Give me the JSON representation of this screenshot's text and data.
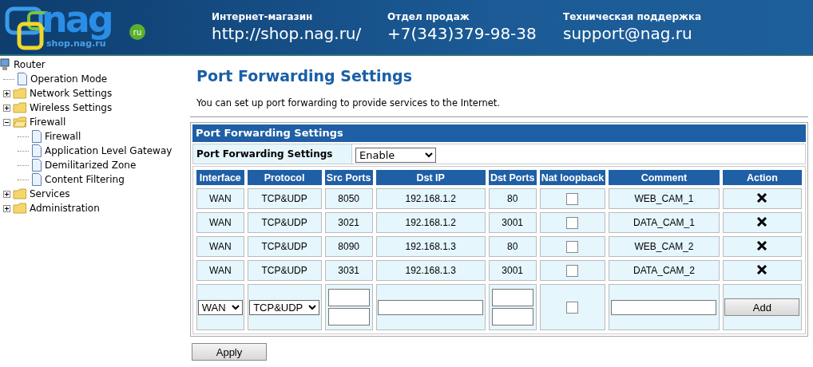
{
  "header": {
    "logo": {
      "name": "nag",
      "site": "shop.nag.ru",
      "badge": "ru"
    },
    "contacts": [
      {
        "label": "Интернет-магазин",
        "value": "http://shop.nag.ru/"
      },
      {
        "label": "Отдел продаж",
        "value": "+7(343)379-98-38"
      },
      {
        "label": "Техническая поддержка",
        "value": "support@nag.ru"
      }
    ]
  },
  "sidebar": {
    "root": "Router",
    "items": [
      {
        "label": "Operation Mode",
        "kind": "page"
      },
      {
        "label": "Network Settings",
        "kind": "folder",
        "expanded": false
      },
      {
        "label": "Wireless Settings",
        "kind": "folder",
        "expanded": false
      },
      {
        "label": "Firewall",
        "kind": "folder",
        "expanded": true,
        "children": [
          {
            "label": "Firewall",
            "kind": "page"
          },
          {
            "label": "Application Level Gateway",
            "kind": "page"
          },
          {
            "label": "Demilitarized Zone",
            "kind": "page"
          },
          {
            "label": "Content Filtering",
            "kind": "page"
          }
        ]
      },
      {
        "label": "Services",
        "kind": "folder",
        "expanded": false
      },
      {
        "label": "Administration",
        "kind": "folder",
        "expanded": false
      }
    ]
  },
  "page": {
    "title": "Port Forwarding Settings",
    "description": "You can set up port forwarding to provide services to the Internet."
  },
  "panel": {
    "title": "Port Forwarding Settings",
    "setting_label": "Port Forwarding Settings",
    "setting_value": "Enable"
  },
  "table": {
    "columns": [
      "Interface",
      "Protocol",
      "Src Ports",
      "Dst IP",
      "Dst Ports",
      "Nat loopback",
      "Comment",
      "Action"
    ],
    "rows": [
      {
        "interface": "WAN",
        "protocol": "TCP&UDP",
        "src_ports": "8050",
        "dst_ip": "192.168.1.2",
        "dst_ports": "80",
        "nat_loopback": false,
        "comment": "WEB_CAM_1"
      },
      {
        "interface": "WAN",
        "protocol": "TCP&UDP",
        "src_ports": "3021",
        "dst_ip": "192.168.1.2",
        "dst_ports": "3001",
        "nat_loopback": false,
        "comment": "DATA_CAM_1"
      },
      {
        "interface": "WAN",
        "protocol": "TCP&UDP",
        "src_ports": "8090",
        "dst_ip": "192.168.1.3",
        "dst_ports": "80",
        "nat_loopback": false,
        "comment": "WEB_CAM_2"
      },
      {
        "interface": "WAN",
        "protocol": "TCP&UDP",
        "src_ports": "3031",
        "dst_ip": "192.168.1.3",
        "dst_ports": "3001",
        "nat_loopback": false,
        "comment": "DATA_CAM_2"
      }
    ],
    "new_entry": {
      "interface": "WAN",
      "protocol": "TCP&UDP",
      "nat_loopback": false,
      "button": "Add"
    }
  },
  "apply_button": "Apply"
}
